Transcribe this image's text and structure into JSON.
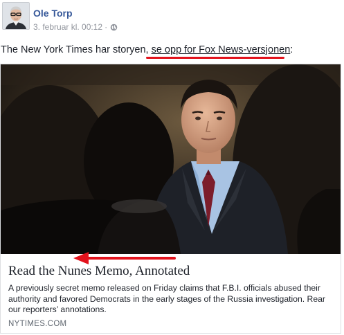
{
  "post": {
    "author": "Ole Torp",
    "timestamp": "3. februar kl. 00:12",
    "separator": "·",
    "privacy_icon": "globe-icon",
    "text_prefix": "The New York Times har storyen, ",
    "text_link": "se opp for Fox News-versjonen",
    "text_suffix": ":"
  },
  "link_card": {
    "title": "Read the Nunes Memo, Annotated",
    "description": "A previously secret memo released on Friday claims that F.B.I. officials abused their authority and favored Democrats in the early stages of the Russia investigation. Rear our reporters’ annotations.",
    "domain": "NYTIMES.COM"
  },
  "annotations": {
    "color": "#e3121c"
  },
  "colors": {
    "author_link": "#365899",
    "meta_text": "#90949c",
    "body_text": "#1d2129",
    "card_border": "#dddfe2"
  }
}
